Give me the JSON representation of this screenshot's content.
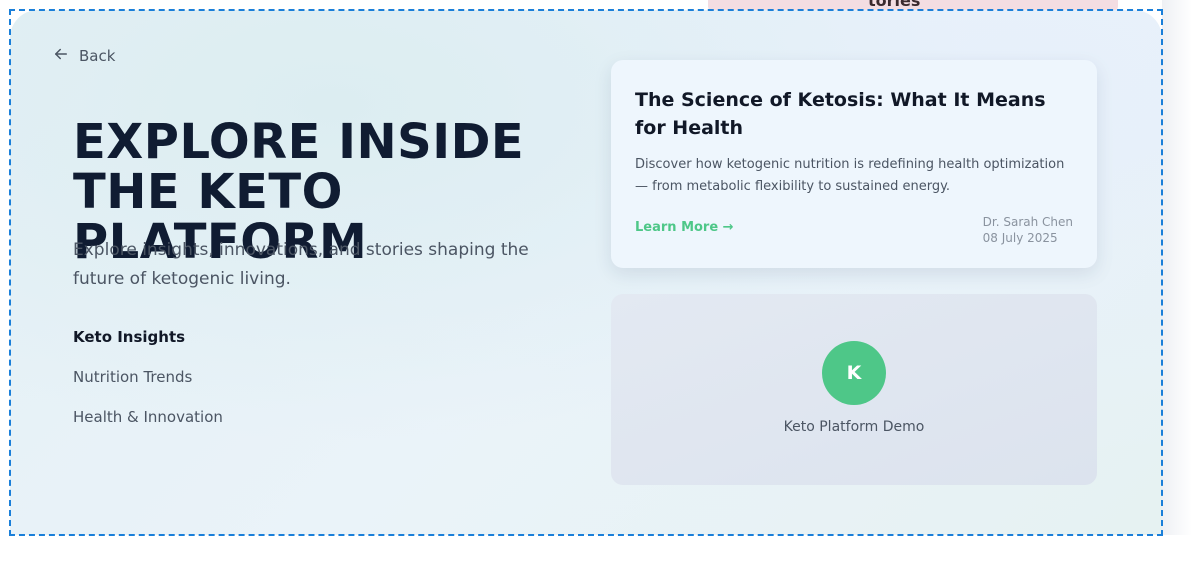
{
  "backdrop": {
    "peek_text": "tories"
  },
  "nav": {
    "back_label": "Back"
  },
  "hero": {
    "title": "EXPLORE INSIDE THE KETO PLATFORM",
    "subtitle": "Explore insights, innovations, and stories shaping the future of ketogenic living."
  },
  "topics": [
    {
      "label": "Keto Insights",
      "active": true
    },
    {
      "label": "Nutrition Trends",
      "active": false
    },
    {
      "label": "Health & Innovation",
      "active": false
    }
  ],
  "article": {
    "title": "The Science of Ketosis: What It Means for Health",
    "description": "Discover how ketogenic nutrition is redefining health optimization — from metabolic flexibility to sustained energy.",
    "cta": "Learn More →",
    "author": "Dr. Sarah Chen",
    "date": "08 July 2025"
  },
  "demo": {
    "avatar_letter": "K",
    "caption": "Keto Platform Demo"
  },
  "colors": {
    "accent_green": "#4ec788",
    "heading_dark": "#101c32",
    "selection_outline": "#1a7fd9"
  },
  "icons": {
    "back": "arrow-left-icon"
  }
}
